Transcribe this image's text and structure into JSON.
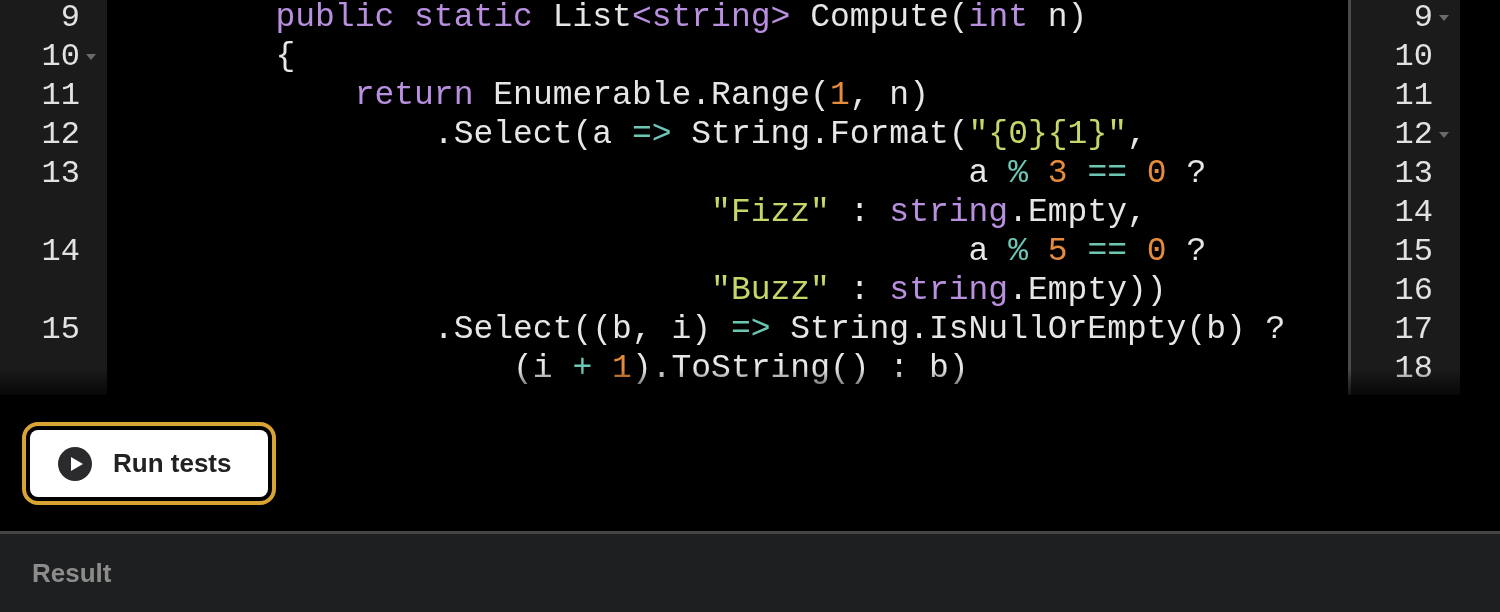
{
  "editor": {
    "rows": [
      {
        "line": "9",
        "fold": false,
        "right_line": "9",
        "right_fold": true,
        "tokens": [
          {
            "kind": "keyword",
            "text": "        public static"
          },
          {
            "kind": "plain",
            "text": " List"
          },
          {
            "kind": "keyword",
            "text": "<string>"
          },
          {
            "kind": "plain",
            "text": " Compute("
          },
          {
            "kind": "keyword",
            "text": "int"
          },
          {
            "kind": "plain",
            "text": " n)"
          }
        ]
      },
      {
        "line": "10",
        "fold": true,
        "right_line": "10",
        "right_fold": false,
        "tokens": [
          {
            "kind": "plain",
            "text": "        {"
          }
        ]
      },
      {
        "line": "11",
        "fold": false,
        "right_line": "11",
        "right_fold": false,
        "tokens": [
          {
            "kind": "keyword",
            "text": "            return"
          },
          {
            "kind": "plain",
            "text": " Enumerable.Range("
          },
          {
            "kind": "number",
            "text": "1"
          },
          {
            "kind": "plain",
            "text": ", n)"
          }
        ]
      },
      {
        "line": "12",
        "fold": false,
        "right_line": "12",
        "right_fold": true,
        "tokens": [
          {
            "kind": "plain",
            "text": "                .Select(a "
          },
          {
            "kind": "operator",
            "text": "=>"
          },
          {
            "kind": "plain",
            "text": " String.Format("
          },
          {
            "kind": "string",
            "text": "\"{0}{1}\""
          },
          {
            "kind": "plain",
            "text": ","
          }
        ]
      },
      {
        "line": "13",
        "fold": false,
        "right_line": "13",
        "right_fold": false,
        "tokens": [
          {
            "kind": "plain",
            "text": "                                           a "
          },
          {
            "kind": "operator",
            "text": "% "
          },
          {
            "kind": "number",
            "text": "3 "
          },
          {
            "kind": "operator",
            "text": "== "
          },
          {
            "kind": "number",
            "text": "0"
          },
          {
            "kind": "plain",
            "text": " ?"
          }
        ]
      },
      {
        "fold": false,
        "right_line": "14",
        "right_fold": false,
        "tokens": [
          {
            "kind": "string",
            "text": "                              \"Fizz\""
          },
          {
            "kind": "plain",
            "text": " : "
          },
          {
            "kind": "keyword",
            "text": "string"
          },
          {
            "kind": "plain",
            "text": ".Empty,"
          }
        ]
      },
      {
        "line": "14",
        "fold": false,
        "right_line": "15",
        "right_fold": false,
        "tokens": [
          {
            "kind": "plain",
            "text": "                                           a "
          },
          {
            "kind": "operator",
            "text": "% "
          },
          {
            "kind": "number",
            "text": "5 "
          },
          {
            "kind": "operator",
            "text": "== "
          },
          {
            "kind": "number",
            "text": "0"
          },
          {
            "kind": "plain",
            "text": " ?"
          }
        ]
      },
      {
        "fold": false,
        "right_line": "16",
        "right_fold": false,
        "tokens": [
          {
            "kind": "string",
            "text": "                              \"Buzz\""
          },
          {
            "kind": "plain",
            "text": " : "
          },
          {
            "kind": "keyword",
            "text": "string"
          },
          {
            "kind": "plain",
            "text": ".Empty))"
          }
        ]
      },
      {
        "line": "15",
        "fold": false,
        "right_line": "17",
        "right_fold": false,
        "tokens": [
          {
            "kind": "plain",
            "text": "                .Select((b, i) "
          },
          {
            "kind": "operator",
            "text": "=>"
          },
          {
            "kind": "plain",
            "text": " String.IsNullOrEmpty(b) ?"
          }
        ]
      },
      {
        "fold": false,
        "right_line": "18",
        "right_fold": false,
        "tokens": [
          {
            "kind": "plain",
            "text": "                    (i "
          },
          {
            "kind": "operator",
            "text": "+ "
          },
          {
            "kind": "number",
            "text": "1"
          },
          {
            "kind": "plain",
            "text": ").ToString() : b)"
          }
        ]
      }
    ]
  },
  "run_button": {
    "label": "Run tests",
    "focused": true
  },
  "result": {
    "title": "Result"
  }
}
